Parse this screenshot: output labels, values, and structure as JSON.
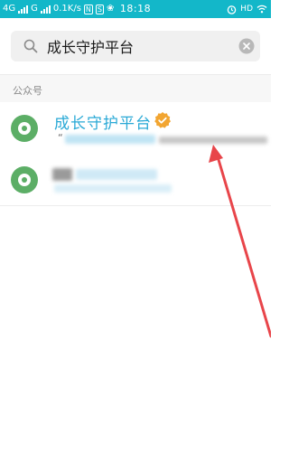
{
  "status_bar": {
    "sim1": "4G",
    "sim2": "G",
    "speed": "0.1K/s",
    "time": "18:18",
    "hd": "HD"
  },
  "search": {
    "query": "成长守护平台",
    "icon": "search-icon",
    "clear_icon": "close-circle-icon"
  },
  "section": {
    "label": "公众号"
  },
  "results": [
    {
      "title": "成长守护平台",
      "verified": true,
      "subtitle_prefix": "“"
    }
  ],
  "colors": {
    "status_bar": "#13b7c9",
    "accent_link": "#2aa9d6",
    "verified_badge": "#f2a531",
    "avatar": "#5cae66",
    "annotation_arrow": "#e8454a"
  }
}
